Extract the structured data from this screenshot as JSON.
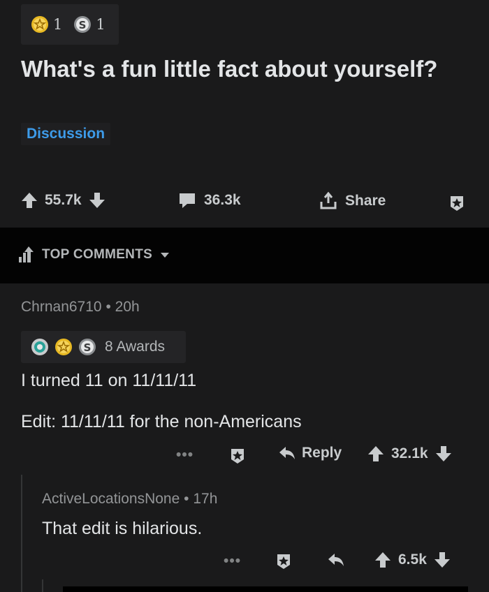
{
  "post": {
    "award_counts": [
      "1",
      "1"
    ],
    "title": "What's a fun little fact about yourself?",
    "flair": "Discussion",
    "upvotes": "55.7k",
    "comments": "36.3k",
    "share_label": "Share"
  },
  "sort": {
    "label": "TOP COMMENTS"
  },
  "comment1": {
    "author": "Chrnan6710",
    "sep": "•",
    "age": "20h",
    "awards_label": "8 Awards",
    "line1": "I turned 11 on 11/11/11",
    "line2": "Edit: 11/11/11 for the non-Americans",
    "more": "•••",
    "reply_label": "Reply",
    "score": "32.1k"
  },
  "comment2": {
    "author": "ActiveLocationsNone",
    "sep": "•",
    "age": "17h",
    "text": "That edit is hilarious.",
    "more": "•••",
    "score": "6.5k"
  },
  "colors": {
    "background": "#1a1a1b",
    "accent_link": "#3d9be9",
    "divider": "#030303"
  }
}
